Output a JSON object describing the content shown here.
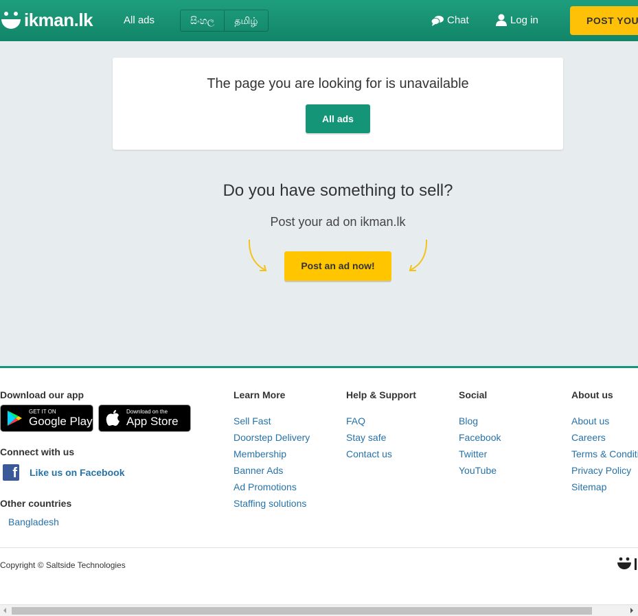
{
  "header": {
    "logo_text": "ikman.lk",
    "all_ads": "All ads",
    "lang_si": "සිංහල",
    "lang_ta": "தமிழ்",
    "chat": "Chat",
    "login": "Log in",
    "post_ad": "POST YOUR AD"
  },
  "notice": {
    "title": "The page you are looking for is unavailable",
    "button": "All ads"
  },
  "sell": {
    "title": "Do you have something to sell?",
    "subtitle": "Post your ad on ikman.lk",
    "button": "Post an ad now!"
  },
  "footer": {
    "download_heading": "Download our app",
    "google_small": "GET IT ON",
    "google_big": "Google Play",
    "apple_small": "Download on the",
    "apple_big": "App Store",
    "connect_heading": "Connect with us",
    "facebook_like": "Like us on Facebook",
    "other_heading": "Other countries",
    "other_link": "Bangladesh",
    "learn_more": {
      "heading": "Learn More",
      "links": [
        "Sell Fast",
        "Doorstep Delivery",
        "Membership",
        "Banner Ads",
        "Ad Promotions",
        "Staffing solutions"
      ]
    },
    "help": {
      "heading": "Help & Support",
      "links": [
        "FAQ",
        "Stay safe",
        "Contact us"
      ]
    },
    "social": {
      "heading": "Social",
      "links": [
        "Blog",
        "Facebook",
        "Twitter",
        "YouTube"
      ]
    },
    "about": {
      "heading": "About us",
      "links": [
        "About us",
        "Careers",
        "Terms & Conditions",
        "Privacy Policy",
        "Sitemap"
      ]
    },
    "copyright": "Copyright © Saltside Technologies",
    "logo_text": "ikman.lk"
  },
  "colors": {
    "brand_green": "#149577",
    "accent_yellow": "#ffc600",
    "link_blue": "#2672a8",
    "page_bg": "#e7ecee"
  }
}
